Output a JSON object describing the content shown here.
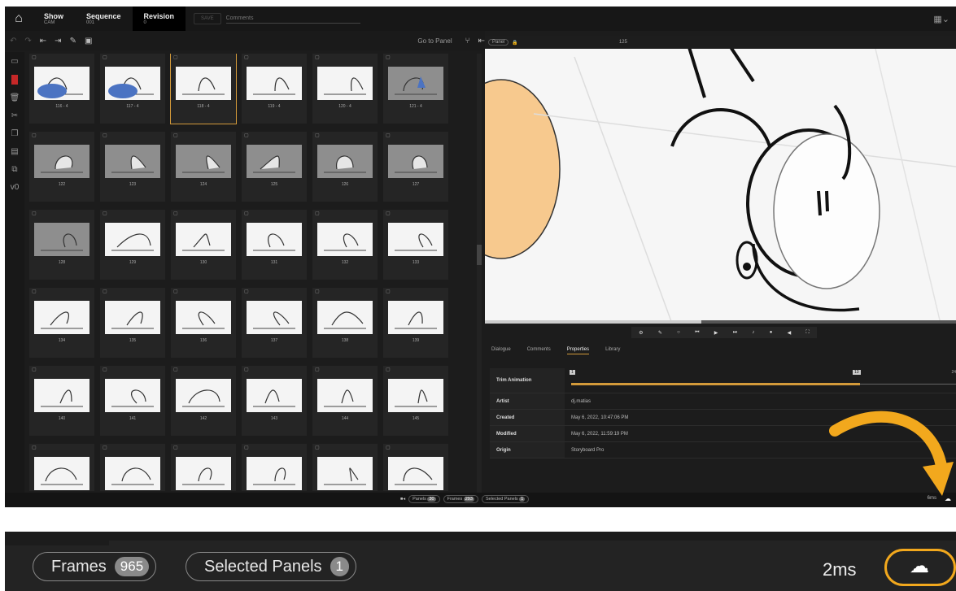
{
  "topbar": {
    "show_label": "Show",
    "show_value": "CAM",
    "sequence_label": "Sequence",
    "sequence_value": "001",
    "revision_label": "Revision",
    "revision_value": "0",
    "save_label": "SAVE",
    "comments_placeholder": "Comments"
  },
  "toolbar": {
    "goto_panel": "Go to Panel"
  },
  "panels": [
    {
      "cap": "116 - 4"
    },
    {
      "cap": "117 - 4"
    },
    {
      "cap": "118 - 4"
    },
    {
      "cap": "119 - 4"
    },
    {
      "cap": "120 - 4"
    },
    {
      "cap": "121 - 4"
    },
    {
      "cap": "122"
    },
    {
      "cap": "123"
    },
    {
      "cap": "124"
    },
    {
      "cap": "125"
    },
    {
      "cap": "126"
    },
    {
      "cap": "127"
    },
    {
      "cap": "128"
    },
    {
      "cap": "129"
    },
    {
      "cap": "130"
    },
    {
      "cap": "131"
    },
    {
      "cap": "132"
    },
    {
      "cap": "133"
    },
    {
      "cap": "134"
    },
    {
      "cap": "135"
    },
    {
      "cap": "136"
    },
    {
      "cap": "137"
    },
    {
      "cap": "138"
    },
    {
      "cap": "139"
    },
    {
      "cap": "140"
    },
    {
      "cap": "141"
    },
    {
      "cap": "142"
    },
    {
      "cap": "143"
    },
    {
      "cap": "144"
    },
    {
      "cap": "145"
    },
    {
      "cap": ""
    },
    {
      "cap": ""
    },
    {
      "cap": ""
    },
    {
      "cap": ""
    },
    {
      "cap": ""
    },
    {
      "cap": ""
    }
  ],
  "selected_panel_index": 2,
  "viewer": {
    "panel_label": "Panel",
    "panel_number": "125",
    "progress": 0.46
  },
  "tabs": [
    "Dialogue",
    "Comments",
    "Properties",
    "Library"
  ],
  "active_tab": "Properties",
  "properties": {
    "trim_label": "Trim Animation",
    "trim_start": "1",
    "trim_end": "13",
    "trim_max": "24",
    "artist_label": "Artist",
    "artist_value": "dj.matias",
    "created_label": "Created",
    "created_value": "May 6, 2022, 10:47:06 PM",
    "modified_label": "Modified",
    "modified_value": "May 6, 2022, 11:59:19 PM",
    "origin_label": "Origin",
    "origin_value": "Storyboard Pro"
  },
  "status": {
    "panels_label": "Panels",
    "panels_count": "30",
    "frames_label": "Frames",
    "frames_count": "293",
    "selected_label": "Selected Panels",
    "selected_count": "1",
    "ms": "6ms"
  },
  "zoom": {
    "frames_label": "Frames",
    "frames_count": "965",
    "selected_label": "Selected Panels",
    "selected_count": "1",
    "ms": "2ms"
  },
  "colors": {
    "accent": "#d39a3a",
    "highlight_ring": "#f2a81d",
    "background": "#1c1c1c"
  }
}
